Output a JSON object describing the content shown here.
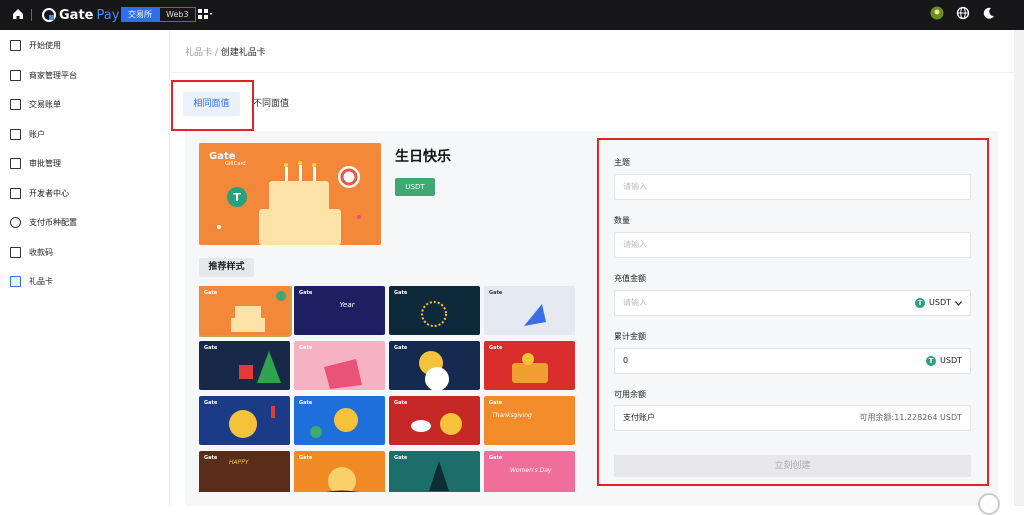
{
  "topbar": {
    "logo_gate": "Gate",
    "logo_pay": "Pay",
    "tabs": [
      {
        "label": "交易所",
        "active": true
      },
      {
        "label": "Web3",
        "active": false
      }
    ],
    "icons": [
      "home-icon",
      "apps-grid-icon",
      "avatar",
      "globe-icon",
      "moon-icon"
    ]
  },
  "sidebar": {
    "items": [
      {
        "label": "开始使用",
        "icon": "getting-started-icon"
      },
      {
        "label": "商家管理平台",
        "icon": "store-icon"
      },
      {
        "label": "交易账单",
        "icon": "bill-icon"
      },
      {
        "label": "账户",
        "icon": "account-icon"
      },
      {
        "label": "审批管理",
        "icon": "approval-icon"
      },
      {
        "label": "开发者中心",
        "icon": "code-icon"
      },
      {
        "label": "支付币种配置",
        "icon": "currency-icon"
      },
      {
        "label": "收款码",
        "icon": "qrcode-icon"
      },
      {
        "label": "礼品卡",
        "icon": "gift-card-icon"
      }
    ]
  },
  "breadcrumb": {
    "parent": "礼品卡",
    "separator": " / ",
    "current": "创建礼品卡"
  },
  "tabs": {
    "same": "相同面值",
    "different": "不同面值"
  },
  "card": {
    "cover_brand": "Gate",
    "cover_sub": "GiftCard",
    "title": "生日快乐",
    "currency_badge": "USDT",
    "recommended_label": "推荐样式",
    "thumb_texts": [
      "",
      "Year",
      "",
      "",
      "",
      "",
      "",
      "",
      "",
      "",
      "",
      "Thanksgiving",
      "HAPPY",
      "",
      "",
      "Women's Day"
    ]
  },
  "form": {
    "subject_label": "主题",
    "subject_placeholder": "请输入",
    "quantity_label": "数量",
    "quantity_placeholder": "请输入",
    "amount_label": "充值金额",
    "amount_placeholder": "请输入",
    "amount_currency": "USDT",
    "total_label": "累计金额",
    "total_value": "0",
    "total_currency": "USDT",
    "balance_label": "可用余额",
    "balance_account": "支付账户",
    "balance_text": "可用余额:11.228264 USDT",
    "submit_label": "立刻创建"
  },
  "colors": {
    "accent": "#2f6fec",
    "badge_green": "#3fa972",
    "highlight_red": "#e02525",
    "cover_orange": "#f3873a"
  }
}
